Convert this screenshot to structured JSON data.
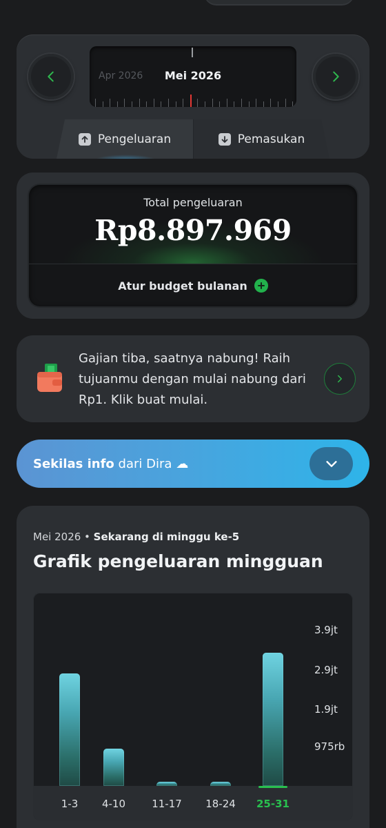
{
  "month_selector": {
    "prev_month": "Apr 2026",
    "current_month": "Mei 2026",
    "tabs": [
      {
        "label": "Pengeluaran",
        "active": true
      },
      {
        "label": "Pemasukan",
        "active": false
      }
    ]
  },
  "total": {
    "label": "Total pengeluaran",
    "amount": "Rp8.897.969",
    "budget_label": "Atur budget bulanan"
  },
  "promo": {
    "text": "Gajian tiba, saatnya nabung! Raih tujuanmu dengan mulai nabung dari Rp1. Klik buat mulai."
  },
  "info": {
    "bold": "Sekilas info",
    "rest": " dari Dira"
  },
  "chart_card": {
    "month": "Mei 2026",
    "separator": " • ",
    "week_note": "Sekarang di minggu ke-5",
    "title": "Grafik pengeluaran mingguan"
  },
  "chart_data": {
    "type": "bar",
    "categories": [
      "1-3",
      "4-10",
      "11-17",
      "18-24",
      "25-31"
    ],
    "values": [
      2830000,
      930000,
      110000,
      110000,
      3340000
    ],
    "current_category": "25-31",
    "y_ticks": [
      "3.9jt",
      "2.9jt",
      "1.9jt",
      "975rb"
    ],
    "y_tick_values": [
      3900000,
      2900000,
      1900000,
      975000
    ],
    "accent": "#29c04f"
  },
  "colors": {
    "background": "#1b1c1e",
    "card": "#2c2f33",
    "green": "#22b14c",
    "red_marker": "#e53935",
    "info_gradient_start": "#5b94d3",
    "info_gradient_end": "#2eb4e9"
  }
}
